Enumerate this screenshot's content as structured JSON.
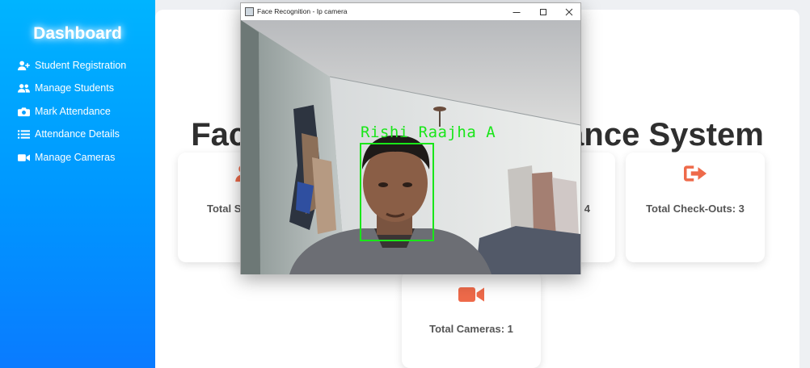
{
  "sidebar": {
    "title": "Dashboard",
    "items": [
      {
        "label": "Student Registration",
        "icon": "user-plus-icon"
      },
      {
        "label": "Manage Students",
        "icon": "users-icon"
      },
      {
        "label": "Mark Attendance",
        "icon": "camera-icon"
      },
      {
        "label": "Attendance Details",
        "icon": "list-icon"
      },
      {
        "label": "Manage Cameras",
        "icon": "video-camera-icon"
      }
    ]
  },
  "main": {
    "title_left": "Fac",
    "title_right": "ance System",
    "cards": {
      "students": {
        "label": "Total S",
        "icon": "users-icon"
      },
      "checkins": {
        "label": "4",
        "icon": "sign-in-icon"
      },
      "checkouts": {
        "label": "Total Check-Outs: 3",
        "icon": "sign-out-icon"
      },
      "cameras": {
        "label": "Total Cameras: 1",
        "icon": "video-camera-icon"
      }
    }
  },
  "window": {
    "title": "Face Recognition - Ip camera",
    "detected_name": "Rishi Raajha A"
  },
  "colors": {
    "sidebar_top": "#00b4ff",
    "sidebar_bottom": "#0a7bff",
    "card_icon": "#ee6a4a",
    "detection_box": "#19e619"
  }
}
